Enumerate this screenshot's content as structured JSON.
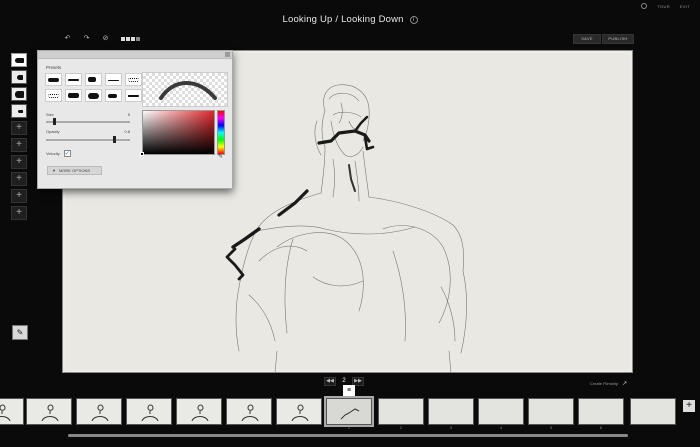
{
  "header": {
    "title": "Looking Up / Looking Down",
    "links": [
      "TOUR",
      "EXIT"
    ],
    "settings_icon": "gear-icon"
  },
  "toolbar": {
    "undo_icon": "↶",
    "redo_icon": "↷",
    "clear_icon": "⊘",
    "save_label": "SAVE",
    "publish_label": "PUBLISH"
  },
  "tools": {
    "add_symbol": "+",
    "eraser_symbol": "✎"
  },
  "brush_panel": {
    "presets_label": "Presets",
    "size_label": "Size",
    "size_value": "5",
    "size_level": 0.08,
    "opacity_label": "Opacity",
    "opacity_value": "0.8",
    "opacity_level": 0.8,
    "velocity_label": "Velocity",
    "velocity_checked": true,
    "velocity_check": "✓",
    "more_options_label": "MORE OPTIONS",
    "more_options_icon": "▼",
    "eyedropper_icon": "✎",
    "hue_color": "#e3262b"
  },
  "playback": {
    "prev_icon": "◀◀",
    "next_icon": "▶▶",
    "current_frame": "2",
    "create_filmstrip_label": "Create Filmstrip",
    "create_filmstrip_icon": "↗"
  },
  "filmstrip": {
    "current_marker": "≡",
    "add_frame_symbol": "+",
    "frame_numbers": [
      "",
      "",
      "",
      "",
      "",
      "",
      "1",
      "2",
      "3",
      "4",
      "5",
      "6",
      ""
    ]
  },
  "colors": {
    "background": "#0a0a0a",
    "canvas": "#e9e8e3",
    "panel": "#e8e8e8"
  }
}
